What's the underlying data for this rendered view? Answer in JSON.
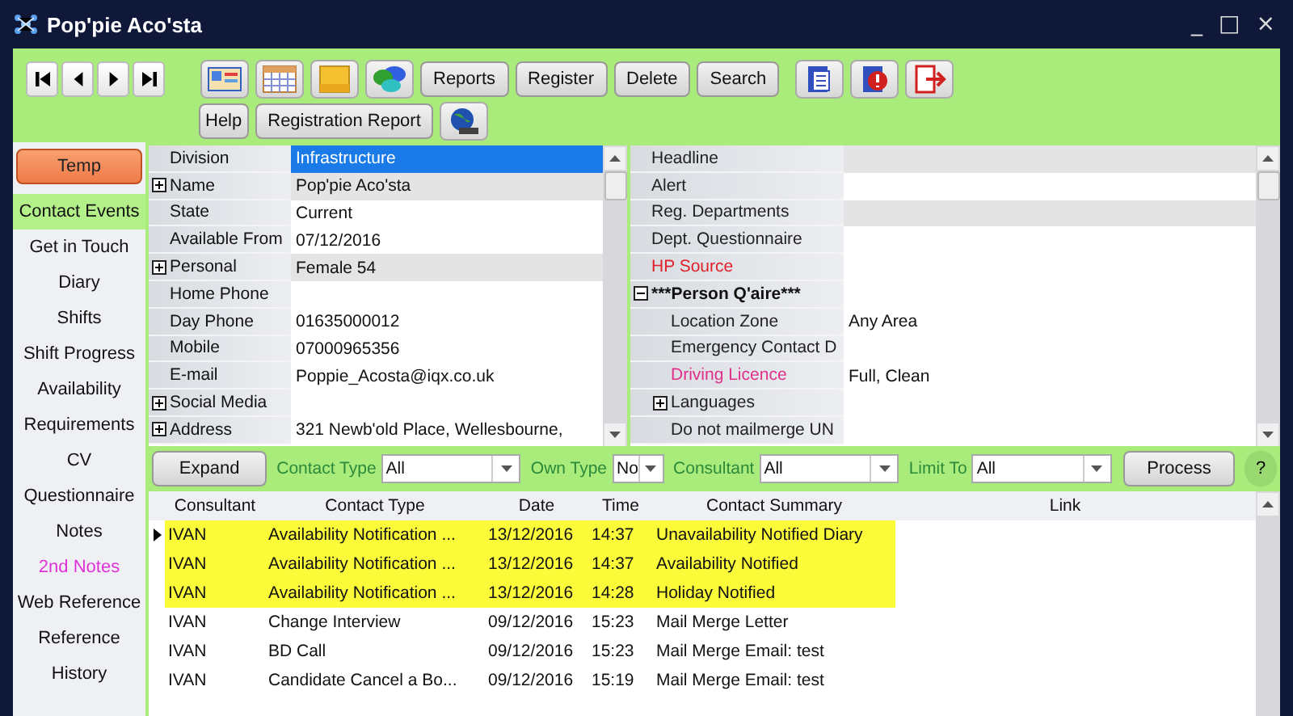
{
  "window": {
    "title": "Pop'pie Aco'sta",
    "controls": [
      "_",
      "□",
      "×"
    ]
  },
  "toolbar": {
    "buttons": [
      "Reports",
      "Register",
      "Delete",
      "Search"
    ],
    "row2_buttons": [
      "Help",
      "Registration Report"
    ]
  },
  "sidebar": {
    "status_button": "Temp",
    "items": [
      {
        "label": "Contact Events",
        "selected": true,
        "flagged": false
      },
      {
        "label": "Get in Touch",
        "selected": false,
        "flagged": false
      },
      {
        "label": "Diary",
        "selected": false,
        "flagged": false
      },
      {
        "label": "Shifts",
        "selected": false,
        "flagged": false
      },
      {
        "label": "Shift Progress",
        "selected": false,
        "flagged": false
      },
      {
        "label": "Availability",
        "selected": false,
        "flagged": false
      },
      {
        "label": "Requirements",
        "selected": false,
        "flagged": false
      },
      {
        "label": "CV",
        "selected": false,
        "flagged": false
      },
      {
        "label": "Questionnaire",
        "selected": false,
        "flagged": false
      },
      {
        "label": "Notes",
        "selected": false,
        "flagged": false
      },
      {
        "label": "2nd Notes",
        "selected": false,
        "flagged": true
      },
      {
        "label": "Web Reference",
        "selected": false,
        "flagged": false
      },
      {
        "label": "Reference",
        "selected": false,
        "flagged": false
      },
      {
        "label": "History",
        "selected": false,
        "flagged": false
      }
    ]
  },
  "left_fields": [
    {
      "label": "Division",
      "value": "Infrastructure",
      "disabled": false,
      "selected": true
    },
    {
      "label": "Name",
      "value": "Pop'pie Aco'sta",
      "expanded": false,
      "disabled": true,
      "selected": false
    },
    {
      "label": "State",
      "value": "Current",
      "disabled": false,
      "selected": false
    },
    {
      "label": "Available From",
      "value": "07/12/2016",
      "disabled": false,
      "selected": false
    },
    {
      "label": "Personal",
      "value": "Female 54",
      "expanded": false,
      "disabled": true,
      "selected": false
    },
    {
      "label": "Home Phone",
      "disabled": false,
      "selected": false
    },
    {
      "label": "Day Phone",
      "value": "01635000012",
      "disabled": false,
      "selected": false
    },
    {
      "label": "Mobile",
      "value": "07000965356",
      "disabled": false,
      "selected": false
    },
    {
      "label": "E-mail",
      "value": "Poppie_Acosta@iqx.co.uk",
      "disabled": false,
      "selected": false
    },
    {
      "label": "Social Media",
      "expanded": false,
      "disabled": false,
      "selected": false
    },
    {
      "label": "Address",
      "value": "321 Newb'old Place, Wellesbourne,",
      "expanded": false,
      "disabled": false,
      "selected": false
    }
  ],
  "right_fields": [
    {
      "label": "Headline",
      "kind": "plain",
      "disabled": true
    },
    {
      "label": "Alert",
      "kind": "plain",
      "disabled": false
    },
    {
      "label": "Reg. Departments",
      "kind": "plain",
      "disabled": true
    },
    {
      "label": "Dept. Questionnaire",
      "kind": "plain",
      "disabled": false
    },
    {
      "label": "HP Source",
      "kind": "required",
      "disabled": false
    },
    {
      "label": "***Person Q'aire***",
      "kind": "heading",
      "disabled": false,
      "expanded": true,
      "children": [
        {
          "label": "Location Zone",
          "value": "Any Area",
          "kind": "plain",
          "disabled": false
        },
        {
          "label": "Emergency Contact D",
          "kind": "plain",
          "disabled": false
        },
        {
          "label": "Driving Licence",
          "value": "Full, Clean",
          "kind": "warning",
          "disabled": false
        },
        {
          "label": "Languages",
          "kind": "plain",
          "disabled": false,
          "expanded": false
        },
        {
          "label": "Do not mailmerge UN",
          "kind": "plain",
          "disabled": false
        }
      ]
    }
  ],
  "filter_bar": {
    "expand_button": "Expand",
    "filters": [
      {
        "label": "Contact Type",
        "value": "All"
      },
      {
        "label": "Own Type",
        "value": "No"
      },
      {
        "label": "Consultant",
        "value": "All"
      },
      {
        "label": "Limit To",
        "value": "All"
      }
    ],
    "process_button": "Process",
    "help_button": "?"
  },
  "table": {
    "columns": [
      "Consultant",
      "Contact Type",
      "Date",
      "Time",
      "Contact Summary",
      "Link"
    ],
    "rows": [
      {
        "selected": true,
        "highlighted": true,
        "cells": [
          "IVAN",
          "Availability Notification ...",
          "13/12/2016",
          "14:37",
          "Unavailability Notified Diary",
          ""
        ]
      },
      {
        "selected": false,
        "highlighted": true,
        "cells": [
          "IVAN",
          "Availability Notification ...",
          "13/12/2016",
          "14:37",
          "Availability Notified",
          ""
        ]
      },
      {
        "selected": false,
        "highlighted": true,
        "cells": [
          "IVAN",
          "Availability Notification ...",
          "13/12/2016",
          "14:28",
          "Holiday Notified",
          ""
        ]
      },
      {
        "selected": false,
        "highlighted": false,
        "cells": [
          "IVAN",
          "Change Interview",
          "09/12/2016",
          "15:23",
          "Mail Merge Letter",
          ""
        ]
      },
      {
        "selected": false,
        "highlighted": false,
        "cells": [
          "IVAN",
          "BD Call",
          "09/12/2016",
          "15:23",
          "Mail Merge Email: test",
          ""
        ]
      },
      {
        "selected": false,
        "highlighted": false,
        "cells": [
          "IVAN",
          "Candidate Cancel a Bo...",
          "09/12/2016",
          "15:19",
          "Mail Merge Email: test",
          ""
        ]
      }
    ]
  }
}
